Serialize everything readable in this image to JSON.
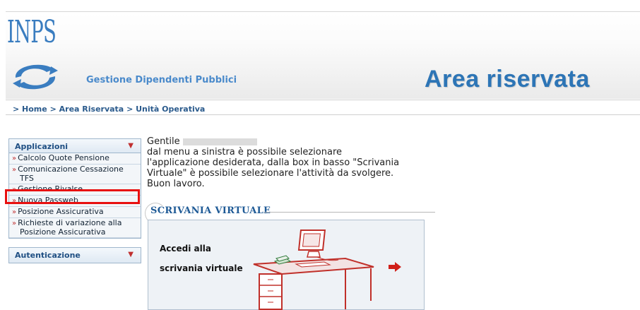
{
  "header": {
    "logo_text": "INPS",
    "subtitle": "Gestione Dipendenti Pubblici",
    "area_title": "Area riservata"
  },
  "breadcrumb": {
    "home": "> Home",
    "area": "> Area Riservata",
    "unit": "> Unità Operativa"
  },
  "sidebar": {
    "applicazioni": {
      "title": "Applicazioni",
      "items": [
        {
          "label": "Calcolo Quote Pensione"
        },
        {
          "label": "Comunicazione Cessazione",
          "label2": "TFS"
        },
        {
          "label": "Gestione Rivalse"
        },
        {
          "label": "Nuova Passweb"
        },
        {
          "label": "Posizione Assicurativa"
        },
        {
          "label": "Richieste di variazione alla",
          "label2": "Posizione Assicurativa"
        }
      ]
    },
    "autenticazione": {
      "title": "Autenticazione"
    }
  },
  "greeting": {
    "hello": "Gentile",
    "line1": "dal menu a sinistra è possibile selezionare",
    "line2": "l'applicazione desiderata, dalla box in basso \"Scrivania",
    "line3": "Virtuale\" è possibile selezionare l'attività da svolgere.",
    "line4": "Buon lavoro."
  },
  "scrivania": {
    "title": "SCRIVANIA VIRTUALE",
    "accedi_line1": "Accedi alla",
    "accedi_line2": "scrivania virtuale"
  },
  "colors": {
    "brand_blue": "#2d75b6",
    "menu_arrow": "#c03030",
    "highlight_red": "#e81010"
  }
}
